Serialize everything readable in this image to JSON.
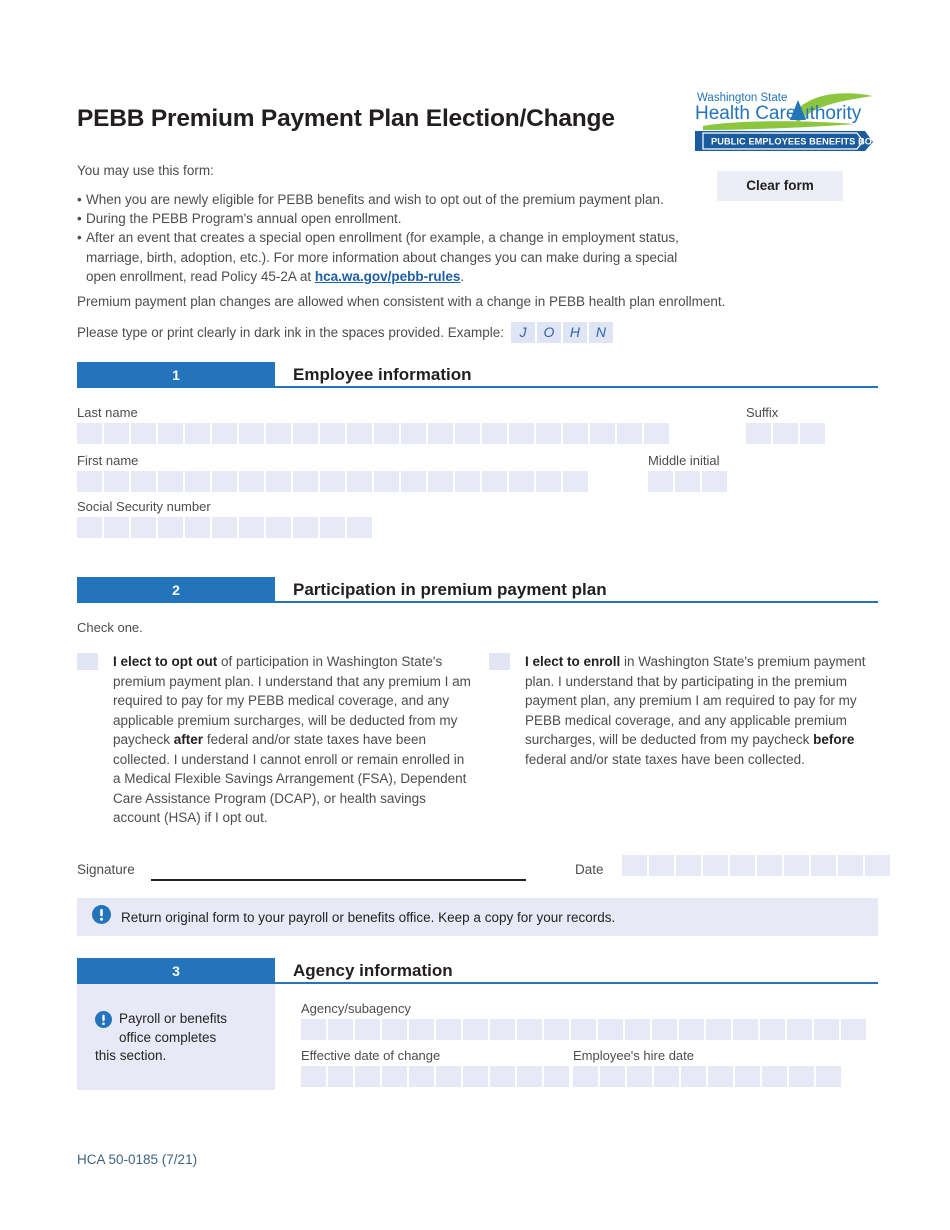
{
  "document": {
    "title": "PEBB Premium Payment Plan Election/Change",
    "footer_code": "HCA 50-0185 (7/21)"
  },
  "logo": {
    "line1": "Washington State",
    "line2_part1": "Health Care ",
    "line2_part2": "Authority",
    "ribbon": "PUBLIC EMPLOYEES BENEFITS BOARD",
    "green": "#8cc63f",
    "blue": "#2474bb",
    "dark_blue": "#1b5c9e"
  },
  "toolbar": {
    "clear_form_label": "Clear form"
  },
  "intro": {
    "lead": "You may use this form:",
    "bullets": [
      "When you are newly eligible for PEBB benefits and wish to opt out of the premium payment plan.",
      "During the PEBB Program's annual open enrollment.",
      "After an event that creates a special open enrollment (for example, a change in employment status, marriage, birth, adoption, etc.). For more information about changes you can make during a special open enrollment, read Policy 45-2A at "
    ],
    "bullet3_link": "hca.wa.gov/pebb-rules",
    "bullet3_tail": ".",
    "paragraph1": "Premium payment plan changes are allowed when consistent with a change in PEBB health plan enrollment.",
    "paragraph2": "Please type or print clearly in dark ink in the spaces provided. Example:",
    "example_letters": [
      "J",
      "O",
      "H",
      "N"
    ]
  },
  "section1": {
    "number": "1",
    "title": "Employee information",
    "fields": {
      "last_name": {
        "label": "Last name",
        "boxes": 22,
        "value": ""
      },
      "suffix": {
        "label": "Suffix",
        "boxes": 3,
        "value": ""
      },
      "first_name": {
        "label": "First name",
        "boxes": 19,
        "value": ""
      },
      "middle_initial": {
        "label": "Middle initial",
        "boxes": 3,
        "value": ""
      },
      "ssn": {
        "label": "Social Security number",
        "boxes": 11,
        "value": ""
      }
    }
  },
  "section2": {
    "number": "2",
    "title": "Participation in premium payment plan",
    "instruction": "Check one.",
    "option_opt_out": {
      "checked": false,
      "bold_lead": "I elect to opt out",
      "text_part1": " of participation in Washington State's premium payment plan. I understand that any premium I am required to pay for my PEBB medical coverage, and any applicable premium surcharges, will be deducted from my paycheck ",
      "bold_mid": "after",
      "text_part2": " federal and/or state taxes have been collected. I understand I cannot enroll or remain enrolled in a Medical Flexible Savings Arrangement (FSA), Dependent Care Assistance Program (DCAP), or health savings account (HSA) if I opt out."
    },
    "option_enroll": {
      "checked": false,
      "bold_lead": "I elect to enroll",
      "text_part1": " in Washington State's premium payment plan. I understand that by participating in the premium payment plan, any premium I am required to pay for my PEBB medical coverage, and any applicable premium surcharges, will be deducted from my paycheck ",
      "bold_mid": "before",
      "text_part2": " federal and/or state taxes have been collected."
    },
    "signature": {
      "label": "Signature",
      "value": ""
    },
    "date": {
      "label": "Date",
      "boxes": 10,
      "value": ""
    },
    "notice": "Return original form to your payroll or benefits office. Keep a copy for your records."
  },
  "section3": {
    "number": "3",
    "title": "Agency information",
    "sidebar_line1": "Payroll or benefits",
    "sidebar_line2": "office completes",
    "sidebar_line3": "this section.",
    "fields": {
      "agency": {
        "label": "Agency/subagency",
        "boxes": 21,
        "value": ""
      },
      "effective_date": {
        "label": "Effective date of change",
        "boxes": 10,
        "value": ""
      },
      "hire_date": {
        "label": "Employee's hire date",
        "boxes": 10,
        "value": ""
      }
    }
  },
  "colors": {
    "header_blue": "#2474bb",
    "field_fill": "#e7eaf6",
    "link_blue": "#1c5fa8",
    "footer_text": "#3f6480"
  }
}
